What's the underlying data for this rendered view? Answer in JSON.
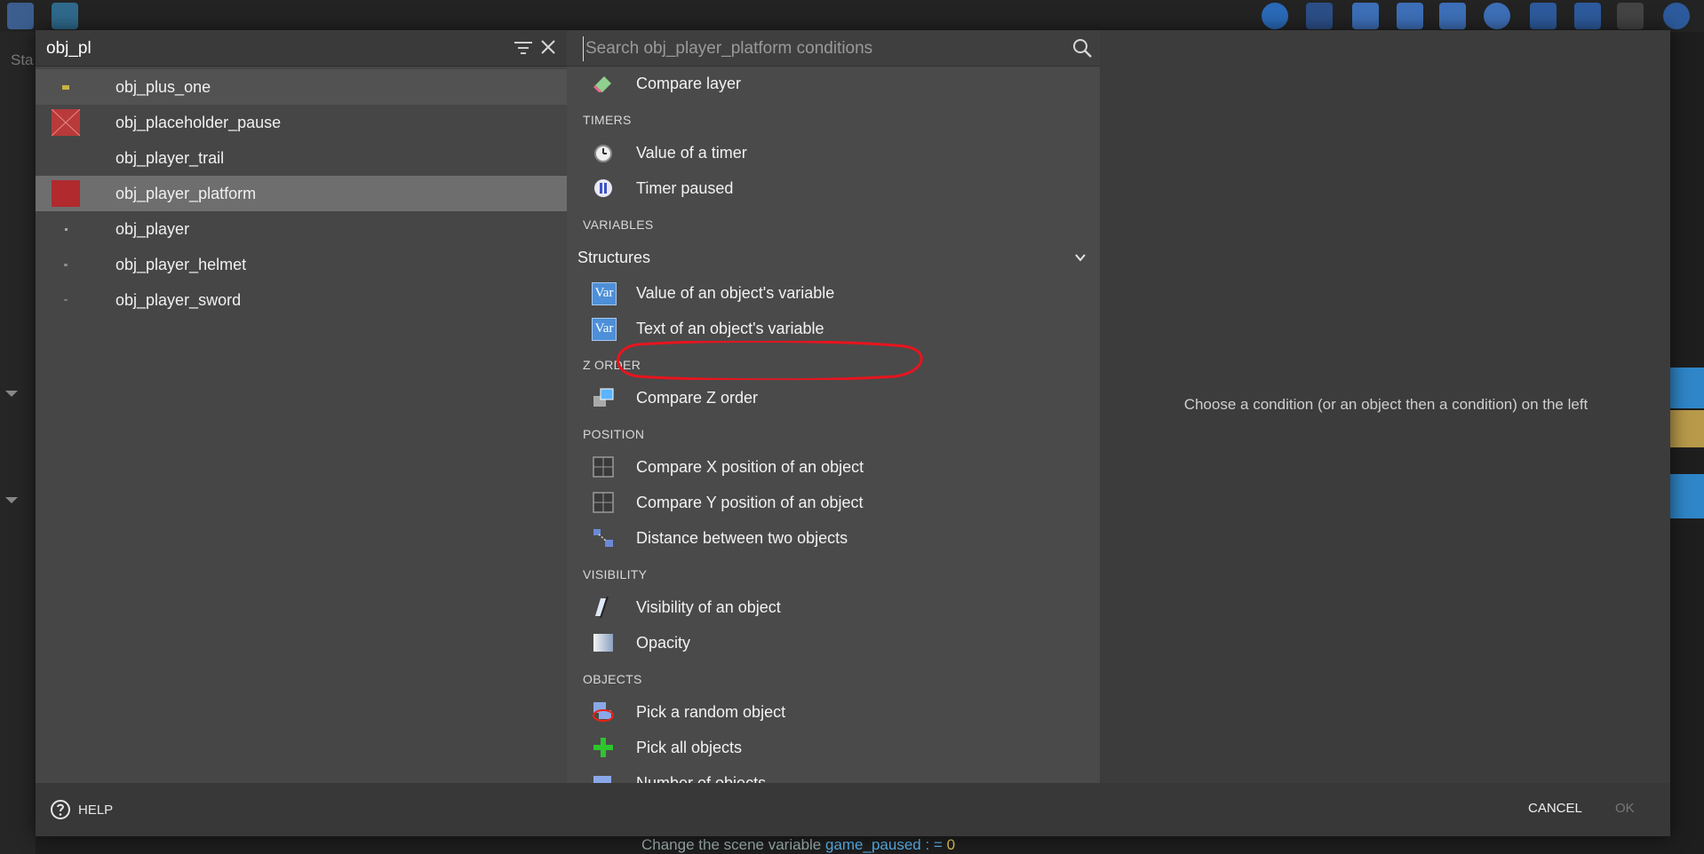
{
  "filter": {
    "value": "obj_pl"
  },
  "search": {
    "placeholder": "Search obj_player_platform conditions"
  },
  "objects": [
    {
      "label": "obj_plus_one",
      "thumb": "tiny-sprite",
      "state": "hover"
    },
    {
      "label": "obj_placeholder_pause",
      "thumb": "red-cross",
      "state": ""
    },
    {
      "label": "obj_player_trail",
      "thumb": "none",
      "state": ""
    },
    {
      "label": "obj_player_platform",
      "thumb": "red-square",
      "state": "selected"
    },
    {
      "label": "obj_player",
      "thumb": "dot",
      "state": ""
    },
    {
      "label": "obj_player_helmet",
      "thumb": "dot",
      "state": ""
    },
    {
      "label": "obj_player_sword",
      "thumb": "dot",
      "state": ""
    }
  ],
  "conditions": {
    "top": {
      "label": "Compare layer",
      "icon": "eraser-icon"
    },
    "timers": {
      "title": "TIMERS",
      "items": [
        {
          "label": "Value of a timer",
          "icon": "alarm-clock-icon"
        },
        {
          "label": "Timer paused",
          "icon": "pause-timer-icon"
        }
      ]
    },
    "variables": {
      "title": "VARIABLES",
      "group": "Structures",
      "items": [
        {
          "label": "Value of an object's variable",
          "icon": "var-icon",
          "icon_text": "Var"
        },
        {
          "label": "Text of an object's variable",
          "icon": "var-icon",
          "icon_text": "Var"
        }
      ]
    },
    "zorder": {
      "title": "Z ORDER",
      "items": [
        {
          "label": "Compare Z order",
          "icon": "layers-icon"
        }
      ]
    },
    "position": {
      "title": "POSITION",
      "items": [
        {
          "label": "Compare X position of an object",
          "icon": "grid-icon"
        },
        {
          "label": "Compare Y position of an object",
          "icon": "grid-icon"
        },
        {
          "label": "Distance between two objects",
          "icon": "distance-icon"
        }
      ]
    },
    "visibility": {
      "title": "VISIBILITY",
      "items": [
        {
          "label": "Visibility of an object",
          "icon": "visibility-icon"
        },
        {
          "label": "Opacity",
          "icon": "opacity-icon"
        }
      ]
    },
    "objects": {
      "title": "OBJECTS",
      "items": [
        {
          "label": "Pick a random object",
          "icon": "random-pick-icon"
        },
        {
          "label": "Pick all objects",
          "icon": "plus-icon"
        },
        {
          "label": "Number of objects",
          "icon": "count-icon"
        }
      ]
    }
  },
  "right": {
    "hint": "Choose a condition (or an object then a condition) on the left"
  },
  "footer": {
    "help": "HELP",
    "cancel": "CANCEL",
    "ok": "OK"
  },
  "background": {
    "tab_fragment": "Sta",
    "event_text_prefix": "Change the scene variable",
    "event_var": "game_paused",
    "event_op": ": =",
    "event_value": "0"
  },
  "colors": {
    "accent_var": "#4d8fd8",
    "selected_row": "#6e6e6e",
    "annotation": "#e8141e"
  }
}
